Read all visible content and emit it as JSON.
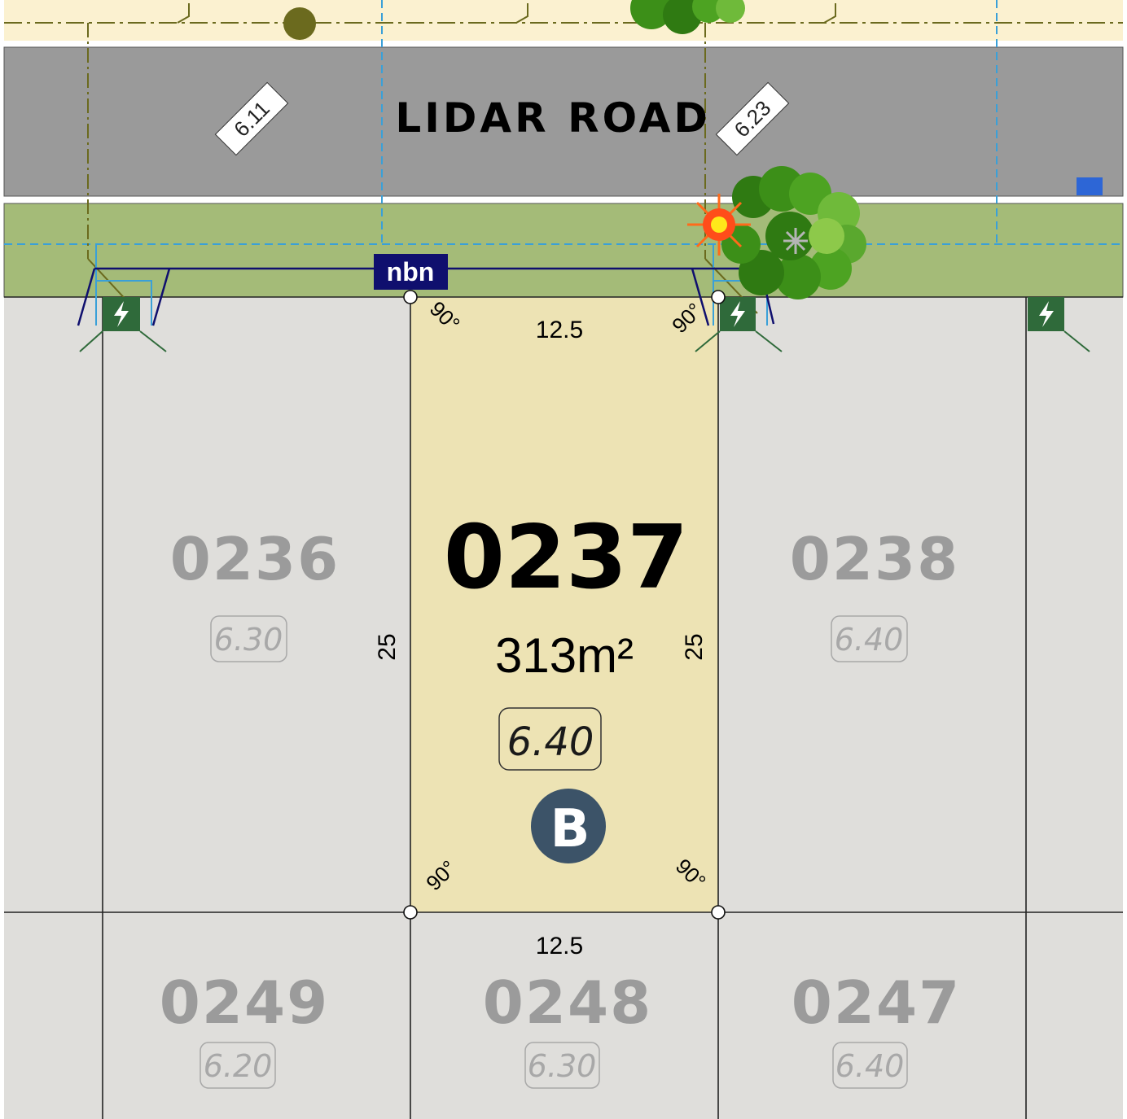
{
  "road": {
    "name_part1": "LIDAR",
    "name_part2": "ROAD",
    "level_left": "6.11",
    "level_right": "6.23"
  },
  "nbn": {
    "label": "nbn"
  },
  "selected_lot": {
    "number": "0237",
    "area": "313m²",
    "level": "6.40",
    "type_badge": "B",
    "frontage": "12.5",
    "rear": "12.5",
    "depth_left": "25",
    "depth_right": "25",
    "angle_top_left": "90°",
    "angle_top_right": "90°",
    "angle_bottom_left": "90°",
    "angle_bottom_right": "90°"
  },
  "lots": [
    {
      "number": "0236",
      "level": "6.30"
    },
    {
      "number": "0238",
      "level": "6.40"
    },
    {
      "number": "0249",
      "level": "6.20"
    },
    {
      "number": "0248",
      "level": "6.30"
    },
    {
      "number": "0247",
      "level": "6.40"
    }
  ],
  "colors": {
    "selected_lot_fill": "#ede3b4",
    "lot_fill": "#dfdedb",
    "road_fill": "#9a9a9a",
    "verge_fill": "#a4bb78",
    "path_fill": "#fbf1d0",
    "nbn_fill": "#0f0f6e",
    "badge_fill": "#3c5368",
    "power_fill": "#2f6a3a",
    "services_line": "#3aa0d8"
  },
  "icons": [
    "power-pit-icon",
    "street-light-icon",
    "tree-icon",
    "service-marker-icon"
  ]
}
